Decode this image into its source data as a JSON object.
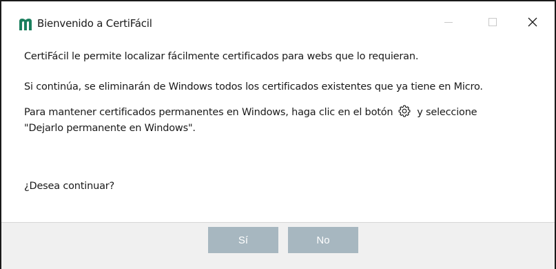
{
  "window": {
    "title": "Bienvenido a CertiFácil",
    "logo_icon": "certifacil-m-logo",
    "accent_color": "#1b7f5e"
  },
  "message": {
    "line1": "CertiFácil le permite localizar fácilmente certificados para webs que lo requieran.",
    "line2": "Si continúa, se eliminarán de Windows todos los certificados existentes que ya tiene en Micro.",
    "line3_before": "Para mantener certificados permanentes en Windows, haga clic en el botón",
    "line3_icon": "gear-icon",
    "line3_after": "y seleccione",
    "line4": "\"Dejarlo permanente en Windows\".",
    "question": "¿Desea continuar?"
  },
  "buttons": {
    "yes": "Sí",
    "no": "No",
    "button_color": "#a7b7c0"
  }
}
